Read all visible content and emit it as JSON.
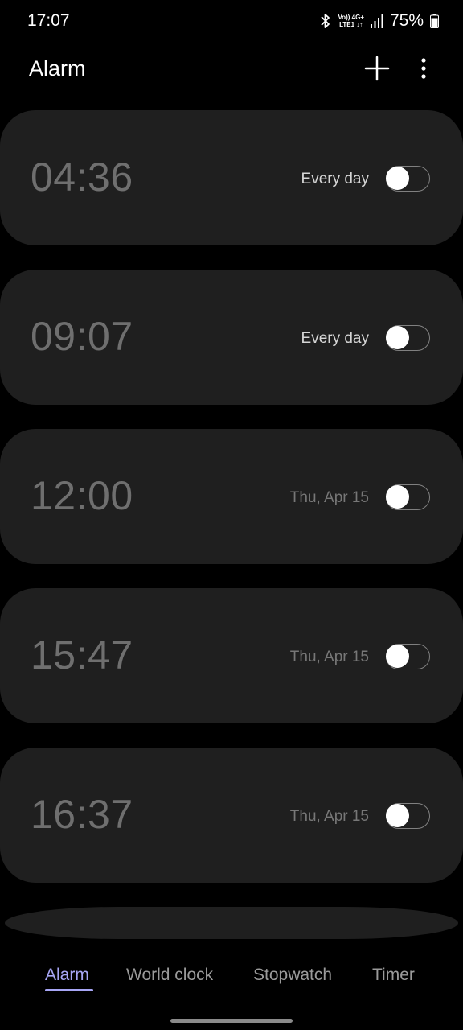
{
  "status_bar": {
    "time": "17:07",
    "network_line1": "Vo)) 4G+",
    "network_line2": "LTE1 ↓↑",
    "battery": "75%",
    "icons": [
      "bluetooth-icon",
      "signal-icon",
      "battery-icon"
    ]
  },
  "header": {
    "title": "Alarm",
    "add_icon": "plus-icon",
    "more_icon": "more-vert-icon"
  },
  "alarms": [
    {
      "time": "04:36",
      "repeat": "Every day",
      "enabled": false
    },
    {
      "time": "09:07",
      "repeat": "Every day",
      "enabled": false
    },
    {
      "time": "12:00",
      "repeat": "Thu, Apr 15",
      "enabled": false
    },
    {
      "time": "15:47",
      "repeat": "Thu, Apr 15",
      "enabled": false
    },
    {
      "time": "16:37",
      "repeat": "Thu, Apr 15",
      "enabled": false
    }
  ],
  "tabs": [
    {
      "label": "Alarm",
      "active": true
    },
    {
      "label": "World clock",
      "active": false
    },
    {
      "label": "Stopwatch",
      "active": false
    },
    {
      "label": "Timer",
      "active": false
    }
  ],
  "colors": {
    "accent": "#a7a6f5",
    "card_bg": "#1f1f1f",
    "background": "#000000"
  }
}
